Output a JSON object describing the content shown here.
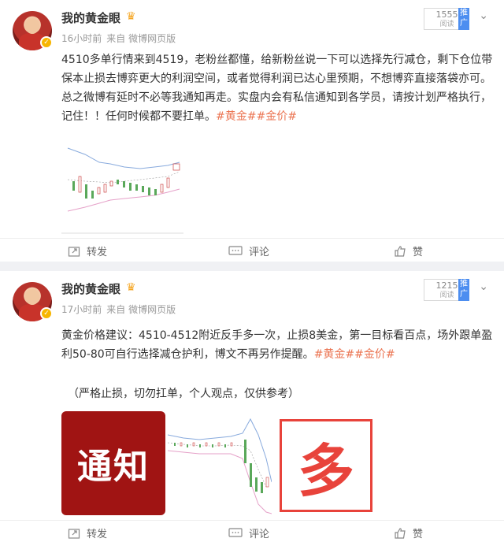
{
  "posts": [
    {
      "username": "我的黄金眼",
      "time": "16小时前",
      "source": "来自 微博网页版",
      "read_count": "1555",
      "read_label": "阅读",
      "promo_label": "推广",
      "text": "4510多单行情来到4519，老粉丝都懂，给新粉丝说一下可以选择先行减仓，剩下仓位带保本止损去博弈更大的利润空间，或者觉得利润已达心里预期，不想博弈直接落袋亦可。总之微博有延时不必等我通知再走。实盘内会有私信通知到各学员，请按计划严格执行，记住！！任何时候都不要扛单。",
      "topics": "#黄金##金价#",
      "repost": "转发",
      "comment": "评论",
      "like": "赞"
    },
    {
      "username": "我的黄金眼",
      "time": "17小时前",
      "source": "来自 微博网页版",
      "read_count": "1215",
      "read_label": "阅读",
      "promo_label": "推广",
      "text": "黄金价格建议：4510-4512附近反手多一次，止损8美金，第一目标看百点，场外跟单盈利50-80可自行选择减仓护利，博文不再另作提醒。",
      "topics": "#黄金##金价#",
      "note": "（严格止损，切勿扛单，个人观点，仅供参考）",
      "image_notice": "通知",
      "image_duo": "多",
      "repost": "转发",
      "comment": "评论",
      "like": "赞"
    }
  ],
  "colors": {
    "topic": "#eb7350",
    "promo": "#4d8ef0",
    "notice_bg": "#a01413",
    "duo_red": "#e8433b"
  }
}
